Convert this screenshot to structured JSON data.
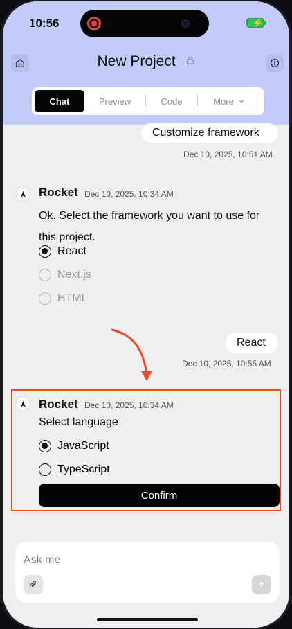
{
  "status_bar": {
    "time": "10:56"
  },
  "header": {
    "title": "New Project",
    "tabs": [
      "Chat",
      "Preview",
      "Code",
      "More"
    ],
    "active_tab": "Chat",
    "icons": {
      "home": "home-icon",
      "lock": "lock-icon",
      "info": "info-icon"
    },
    "accent_color": "#c3ccf8"
  },
  "chat": {
    "messages": [
      {
        "type": "user",
        "text": "Customize framework",
        "timestamp": "Dec 10, 2025, 10:51 AM"
      },
      {
        "type": "bot",
        "sender": "Rocket",
        "timestamp": "Dec 10, 2025, 10:34 AM",
        "text": "Ok. Select the framework you want to use for this project.",
        "options": [
          "React",
          "Next.js",
          "HTML"
        ],
        "selected": "React"
      },
      {
        "type": "user",
        "text": "React",
        "timestamp": "Dec 10, 2025, 10:55 AM"
      },
      {
        "type": "bot",
        "sender": "Rocket",
        "timestamp": "Dec 10, 2025, 10:34 AM",
        "text": "Select language",
        "options": [
          "JavaScript",
          "TypeScript"
        ],
        "selected": "JavaScript",
        "action_label": "Confirm"
      }
    ]
  },
  "composer": {
    "placeholder": "Ask me",
    "icons": {
      "attach": "paperclip-icon",
      "send": "arrow-up-icon"
    }
  },
  "colors": {
    "highlight": "#ea4b2c"
  }
}
